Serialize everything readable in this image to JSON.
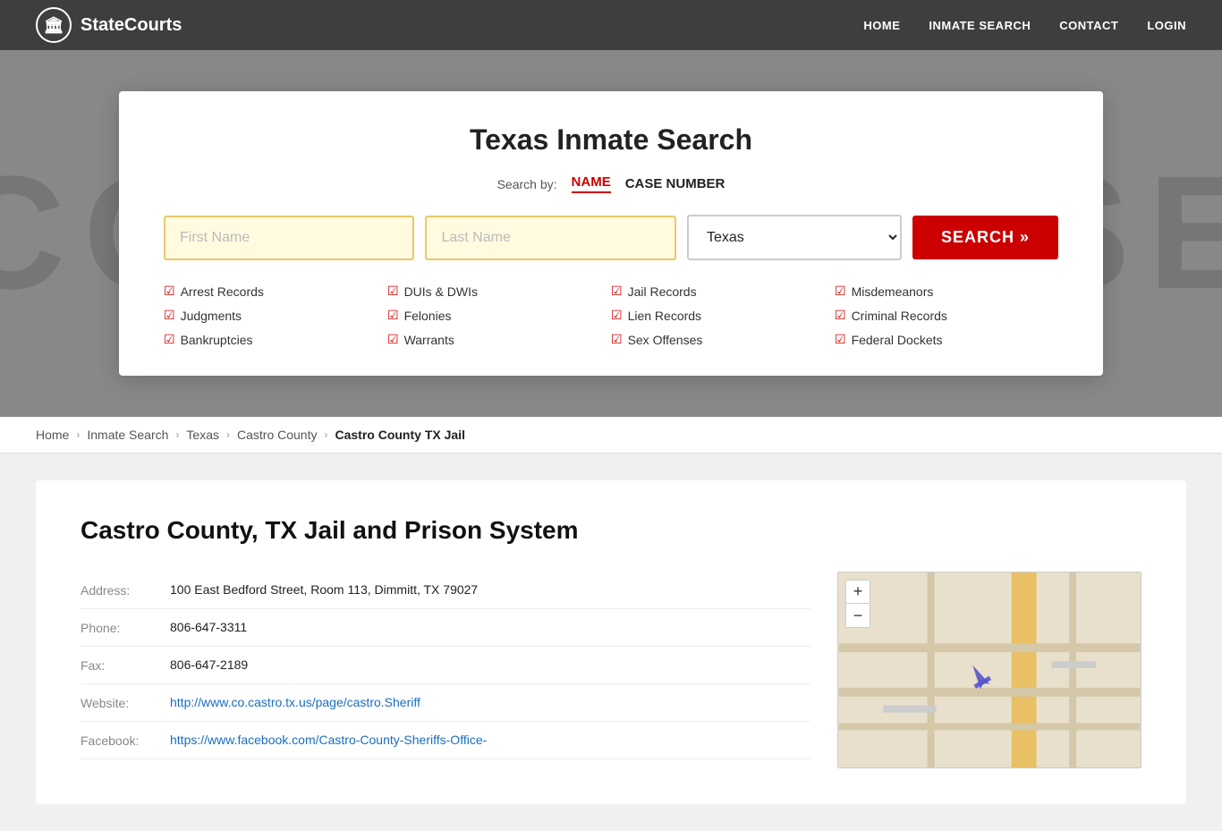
{
  "site": {
    "name": "StateCourts",
    "logo_symbol": "🏛"
  },
  "nav": {
    "links": [
      "HOME",
      "INMATE SEARCH",
      "CONTACT",
      "LOGIN"
    ]
  },
  "hero_bg_text": "COURTHOUSE",
  "search_card": {
    "title": "Texas Inmate Search",
    "search_by_label": "Search by:",
    "tab_name": "NAME",
    "tab_case": "CASE NUMBER",
    "first_name_placeholder": "First Name",
    "last_name_placeholder": "Last Name",
    "state_value": "Texas",
    "search_button": "SEARCH »",
    "features": [
      "Arrest Records",
      "DUIs & DWIs",
      "Jail Records",
      "Misdemeanors",
      "Judgments",
      "Felonies",
      "Lien Records",
      "Criminal Records",
      "Bankruptcies",
      "Warrants",
      "Sex Offenses",
      "Federal Dockets"
    ]
  },
  "breadcrumb": {
    "items": [
      "Home",
      "Inmate Search",
      "Texas",
      "Castro County",
      "Castro County TX Jail"
    ]
  },
  "content": {
    "title": "Castro County, TX Jail and Prison System",
    "address_label": "Address:",
    "address_value": "100 East Bedford Street, Room 113, Dimmitt, TX 79027",
    "phone_label": "Phone:",
    "phone_value": "806-647-3311",
    "fax_label": "Fax:",
    "fax_value": "806-647-2189",
    "website_label": "Website:",
    "website_url": "http://www.co.castro.tx.us/page/castro.Sheriff",
    "website_display": "http://www.co.castro.tx.us/page/castro.Sheriff",
    "facebook_label": "Facebook:",
    "facebook_url": "https://www.facebook.com/Castro-County-Sheriffs-Office-",
    "facebook_display": "https://www.facebook.com/Castro-County-Sheriffs-Office-"
  },
  "map": {
    "zoom_in": "+",
    "zoom_out": "−"
  }
}
